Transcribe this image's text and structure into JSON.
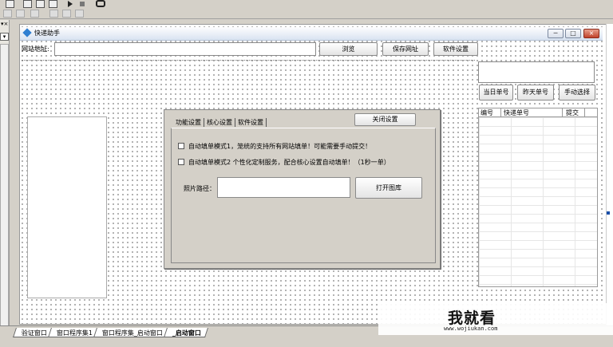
{
  "window": {
    "title": "快递助手"
  },
  "toolbar": {
    "url_label": "网站地址:",
    "url_value": "",
    "browse_label": "浏览",
    "save_url_label": "保存网址",
    "settings_label": "软件设置"
  },
  "right_panel": {
    "today_label": "当日单号",
    "yesterday_label": "昨天单号",
    "manual_label": "手动选择",
    "columns": [
      "编号",
      "快递单号",
      "提交"
    ]
  },
  "dialog": {
    "tabs": [
      "功能设置",
      "核心设置",
      "软件设置"
    ],
    "close_label": "关闭设置",
    "option1": "自动填单模式1，笼统的支持所有网站填单！可能需要手动提交！",
    "option2": "自动填单模式2 个性化定制服务，配合核心设置自动填单！（1秒一单）",
    "photo_label": "照片路径：",
    "photo_value": "",
    "open_gallery_label": "打开图库"
  },
  "bottom_tabs": [
    "验证窗口",
    "窗口程序集1",
    "窗口程序集_启动窗口",
    "_启动窗口"
  ],
  "watermark": {
    "brand": "我就看",
    "url": "www.wojiukan.com"
  }
}
